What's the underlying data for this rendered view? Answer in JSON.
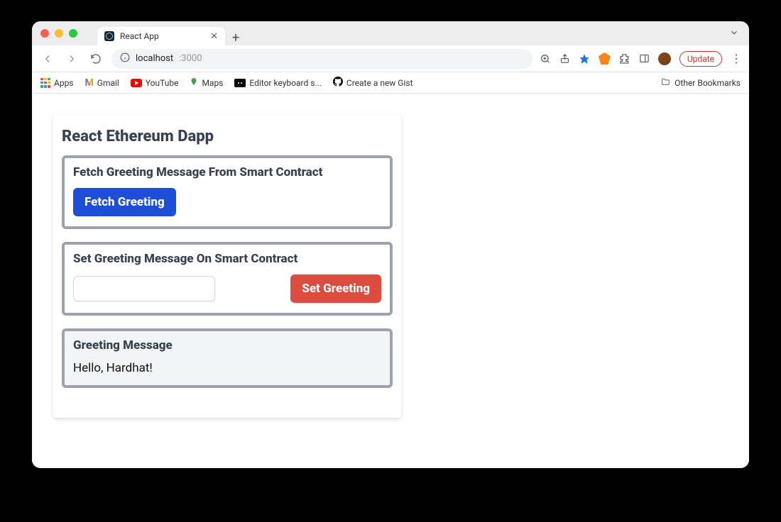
{
  "browser": {
    "tab_title": "React App",
    "url_host": "localhost",
    "url_port": ":3000",
    "update_label": "Update"
  },
  "bookmarks": {
    "apps": "Apps",
    "gmail": "Gmail",
    "youtube": "YouTube",
    "maps": "Maps",
    "editor": "Editor keyboard s...",
    "gist": "Create a new Gist",
    "other": "Other Bookmarks"
  },
  "app": {
    "title": "React Ethereum Dapp",
    "fetch": {
      "heading": "Fetch Greeting Message From Smart Contract",
      "button": "Fetch Greeting"
    },
    "set": {
      "heading": "Set Greeting Message On Smart Contract",
      "input_value": "",
      "button": "Set Greeting"
    },
    "result": {
      "heading": "Greeting Message",
      "value": "Hello, Hardhat!"
    }
  }
}
